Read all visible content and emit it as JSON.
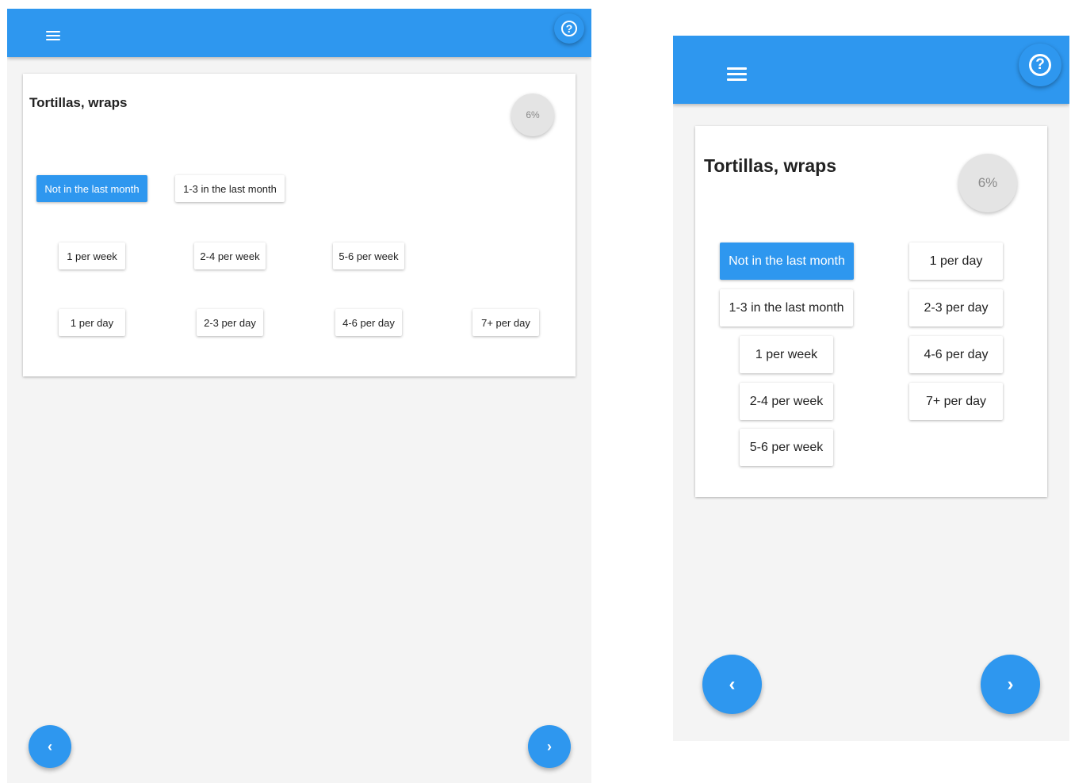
{
  "app": {
    "header": {
      "menu_icon": "hamburger-menu-icon",
      "help_icon": "help-question-icon",
      "help_glyph": "?"
    },
    "food": {
      "title": "Tortillas, wraps"
    },
    "progress": {
      "label": "6%",
      "value_percent": 6
    },
    "options": [
      {
        "label": "Not in the last month",
        "selected": true
      },
      {
        "label": "1-3 in the last month",
        "selected": false
      },
      {
        "label": "1 per week",
        "selected": false
      },
      {
        "label": "2-4 per week",
        "selected": false
      },
      {
        "label": "5-6 per week",
        "selected": false
      },
      {
        "label": "1 per day",
        "selected": false
      },
      {
        "label": "2-3 per day",
        "selected": false
      },
      {
        "label": "4-6 per day",
        "selected": false
      },
      {
        "label": "7+ per day",
        "selected": false
      }
    ],
    "nav": {
      "prev_glyph": "‹",
      "next_glyph": "›"
    },
    "colors": {
      "primary": "#2e97ef",
      "background": "#f4f4f4",
      "badge": "#e4e4e4"
    }
  }
}
